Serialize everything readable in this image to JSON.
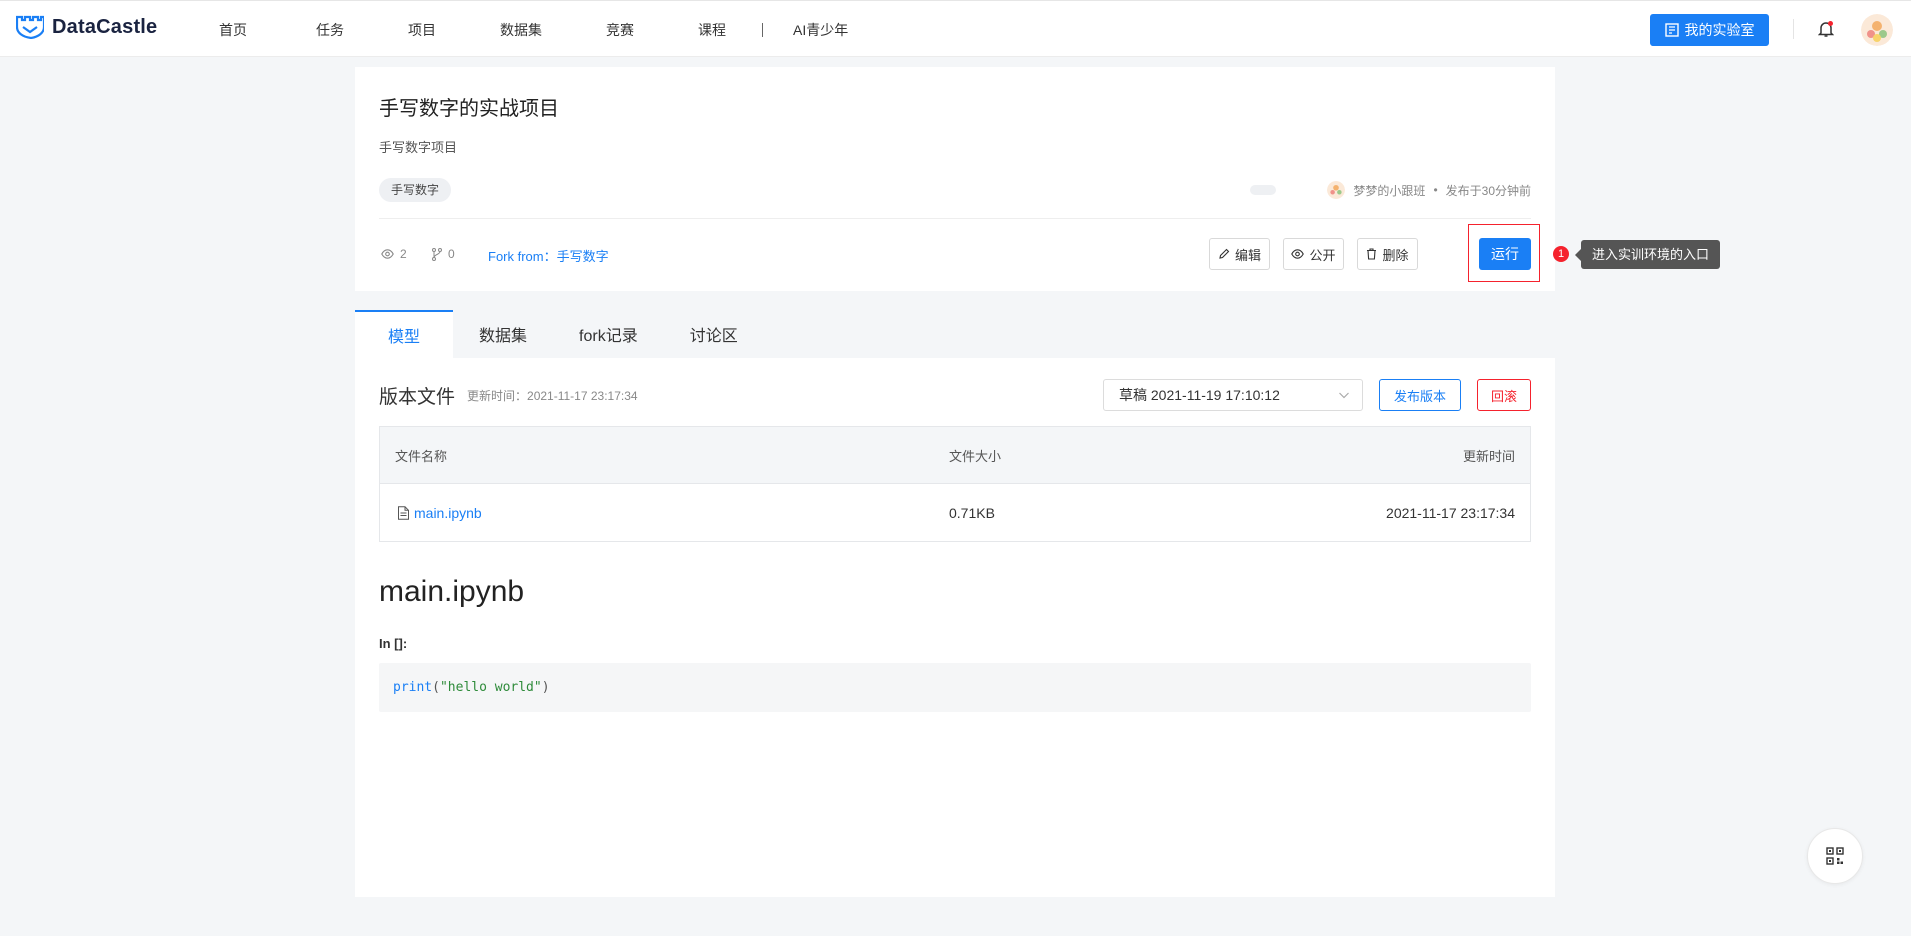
{
  "header": {
    "logo_text": "DataCastle",
    "nav": [
      "首页",
      "任务",
      "项目",
      "数据集",
      "竞赛",
      "课程",
      "AI青少年"
    ],
    "lab_button": "我的实验室"
  },
  "project": {
    "title": "手写数字的实战项目",
    "description": "手写数字项目",
    "tag": "手写数字",
    "author": "梦梦的小跟班",
    "separator_dot": "•",
    "published": "发布于30分钟前",
    "views": "2",
    "forks": "0",
    "fork_from_label": "Fork from：",
    "fork_from_link": "手写数字",
    "actions": {
      "edit": "编辑",
      "public": "公开",
      "delete": "删除",
      "run": "运行"
    },
    "guide_step": "1",
    "guide_tip": "进入实训环境的入口"
  },
  "tabs": [
    "模型",
    "数据集",
    "fork记录",
    "讨论区"
  ],
  "files": {
    "section_title": "版本文件",
    "updated_label": "更新时间：",
    "updated_value": "2021-11-17 23:17:34",
    "version_selected": "草稿 2021-11-19 17:10:12",
    "publish_button": "发布版本",
    "rollback_button": "回滚",
    "columns": [
      "文件名称",
      "文件大小",
      "更新时间"
    ],
    "rows": [
      {
        "name": "main.ipynb",
        "size": "0.71KB",
        "time": "2021-11-17 23:17:34"
      }
    ]
  },
  "notebook": {
    "title": "main.ipynb",
    "cell_label": "In []:",
    "code_fn": "print",
    "code_open": "(",
    "code_str": "\"hello world\"",
    "code_close": ")"
  },
  "colors": {
    "accent": "#1a7ff5",
    "danger": "#f5222d",
    "background": "#f4f6f8"
  }
}
